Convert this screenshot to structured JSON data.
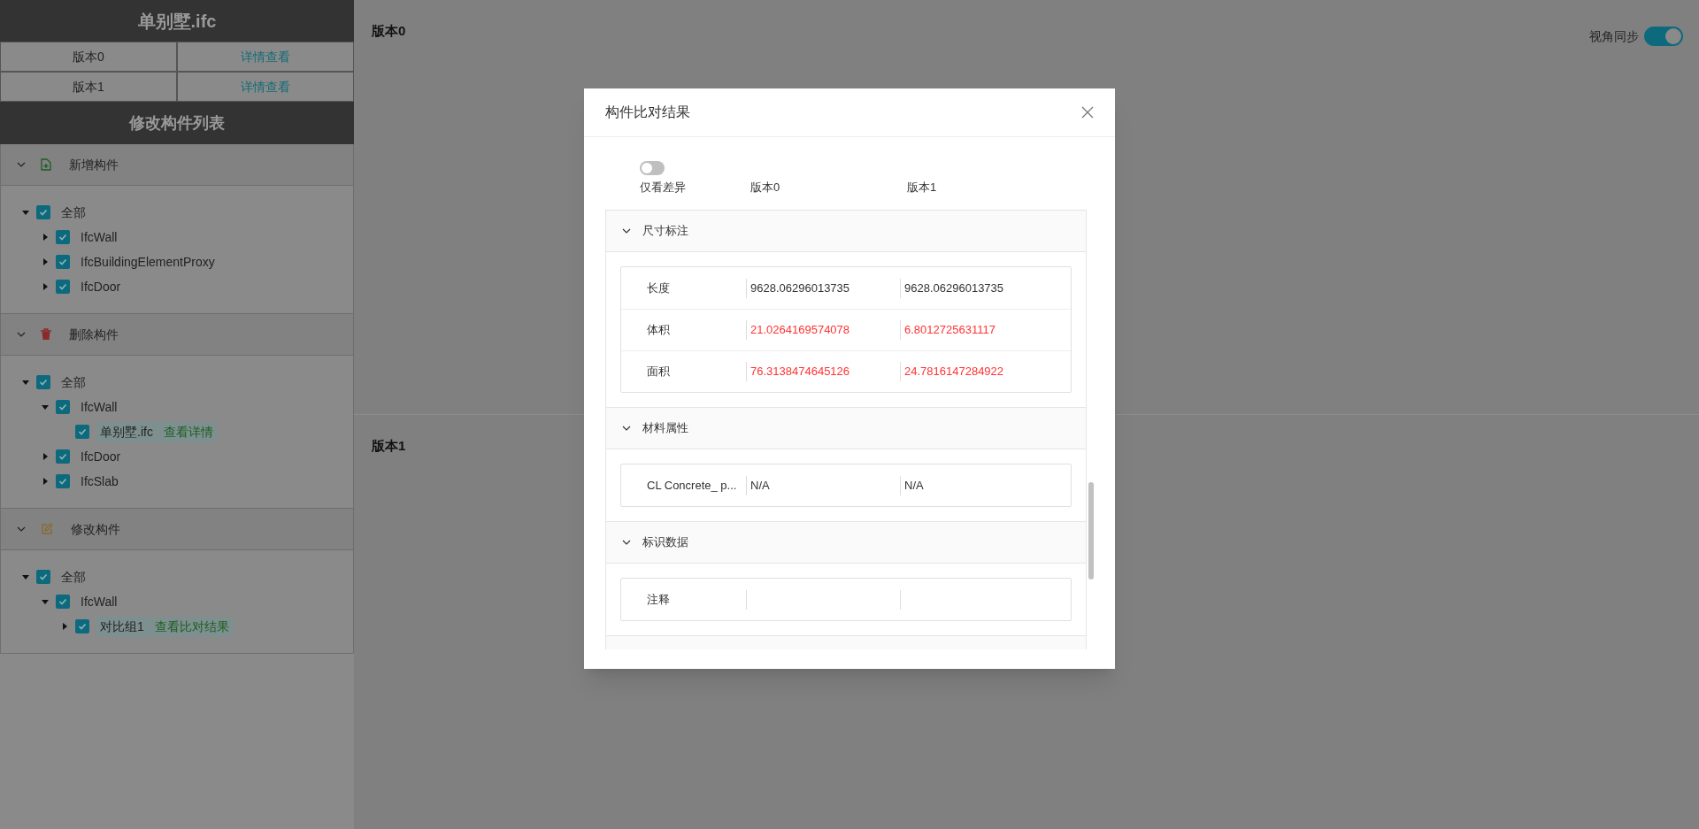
{
  "sidebar": {
    "title": "单别墅.ifc",
    "versions": [
      {
        "label": "版本0",
        "link": "详情查看"
      },
      {
        "label": "版本1",
        "link": "详情查看"
      }
    ],
    "list_title": "修改构件列表",
    "groups": [
      {
        "kind": "added",
        "title": "新增构件",
        "expanded": true,
        "tree": [
          {
            "label": "全部",
            "checked": true,
            "selected": false,
            "expanded": true,
            "children": [
              {
                "label": "IfcWall",
                "checked": true,
                "selected": false,
                "expanded": false
              },
              {
                "label": "IfcBuildingElementProxy",
                "checked": true,
                "selected": false,
                "expanded": false
              },
              {
                "label": "IfcDoor",
                "checked": true,
                "selected": false,
                "expanded": false
              }
            ]
          }
        ]
      },
      {
        "kind": "deleted",
        "title": "删除构件",
        "expanded": true,
        "tree": [
          {
            "label": "全部",
            "checked": true,
            "selected": false,
            "expanded": true,
            "children": [
              {
                "label": "IfcWall",
                "checked": true,
                "selected": false,
                "expanded": true,
                "children": [
                  {
                    "label": "单别墅.ifc",
                    "checked": true,
                    "selected": true,
                    "action": "查看详情"
                  }
                ]
              },
              {
                "label": "IfcDoor",
                "checked": true,
                "selected": false,
                "expanded": false
              },
              {
                "label": "IfcSlab",
                "checked": true,
                "selected": false,
                "expanded": false
              }
            ]
          }
        ]
      },
      {
        "kind": "modified",
        "title": "修改构件",
        "expanded": true,
        "tree": [
          {
            "label": "全部",
            "checked": true,
            "selected": false,
            "expanded": true,
            "children": [
              {
                "label": "IfcWall",
                "checked": true,
                "selected": false,
                "expanded": true,
                "children": [
                  {
                    "label": "对比组1",
                    "checked": true,
                    "selected": true,
                    "expanded": false,
                    "action": "查看比对结果"
                  }
                ]
              }
            ]
          }
        ]
      }
    ]
  },
  "viewer": {
    "panels": [
      {
        "title": "版本0"
      },
      {
        "title": "版本1"
      }
    ],
    "sync": {
      "label": "视角同步",
      "on": true
    }
  },
  "modal": {
    "title": "构件比对结果",
    "diff_only": {
      "label": "仅看差异",
      "on": false
    },
    "columns": [
      "版本0",
      "版本1"
    ],
    "sections": [
      {
        "title": "尺寸标注",
        "expanded": true,
        "rows": [
          {
            "name": "长度",
            "v0": "9628.06296013735",
            "v1": "9628.06296013735",
            "differs": false
          },
          {
            "name": "体积",
            "v0": "21.0264169574078",
            "v1": "6.8012725631117",
            "differs": true
          },
          {
            "name": "面积",
            "v0": "76.3138474645126",
            "v1": "24.7816147284922",
            "differs": true
          }
        ]
      },
      {
        "title": "材料属性",
        "expanded": true,
        "rows": [
          {
            "name": "CL Concrete_ p...",
            "v0": "N/A",
            "v1": "N/A",
            "differs": false
          }
        ]
      },
      {
        "title": "标识数据",
        "expanded": true,
        "rows": [
          {
            "name": "注释"
          }
        ]
      }
    ]
  }
}
